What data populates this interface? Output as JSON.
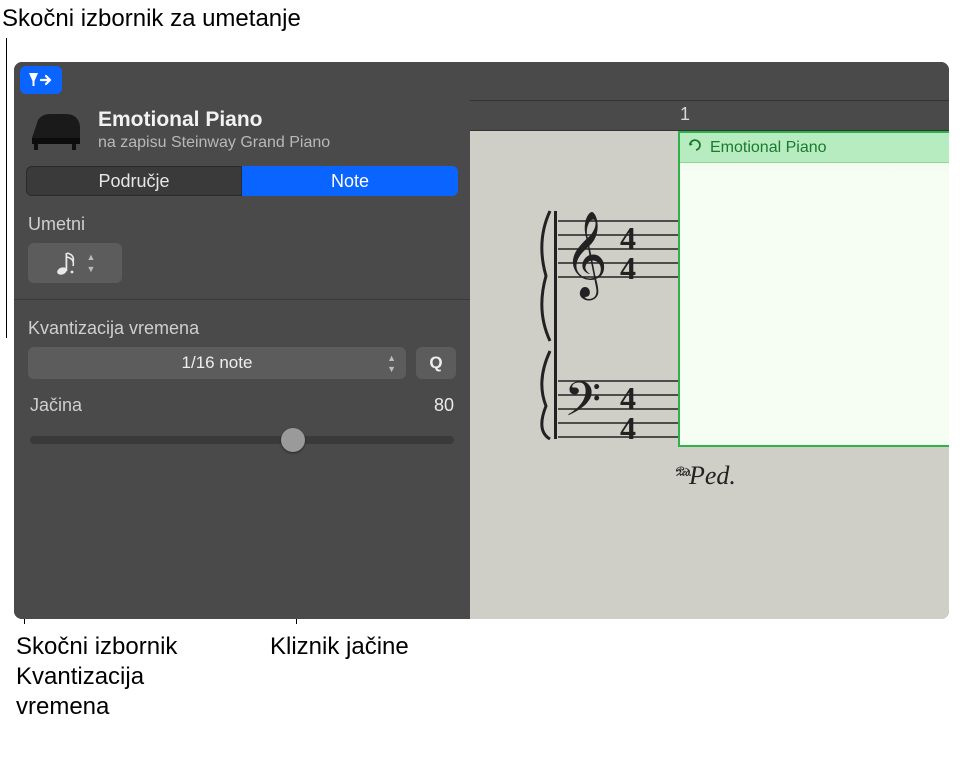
{
  "callouts": {
    "insert_popup": "Skočni izbornik za umetanje",
    "quantize_popup": "Skočni izbornik\nKvantizacija\nvremena",
    "strength_slider": "Kliznik jačine"
  },
  "header": {
    "region_name": "Emotional Piano",
    "track_prefix": "na zapisu",
    "track_name": "Steinway Grand Piano"
  },
  "tabs": {
    "region": "Područje",
    "notes": "Note"
  },
  "insert": {
    "label": "Umetni",
    "note_icon": "sixteenth-note"
  },
  "quantize": {
    "label": "Kvantizacija vremena",
    "value": "1/16 note",
    "button": "Q"
  },
  "strength": {
    "label": "Jačina",
    "value": 80,
    "slider_percent": 62
  },
  "ruler": {
    "bar": "1"
  },
  "score": {
    "region_title": "Emotional Piano",
    "time_signature": "4/4",
    "pedal_marking": "𝆮Ped."
  }
}
